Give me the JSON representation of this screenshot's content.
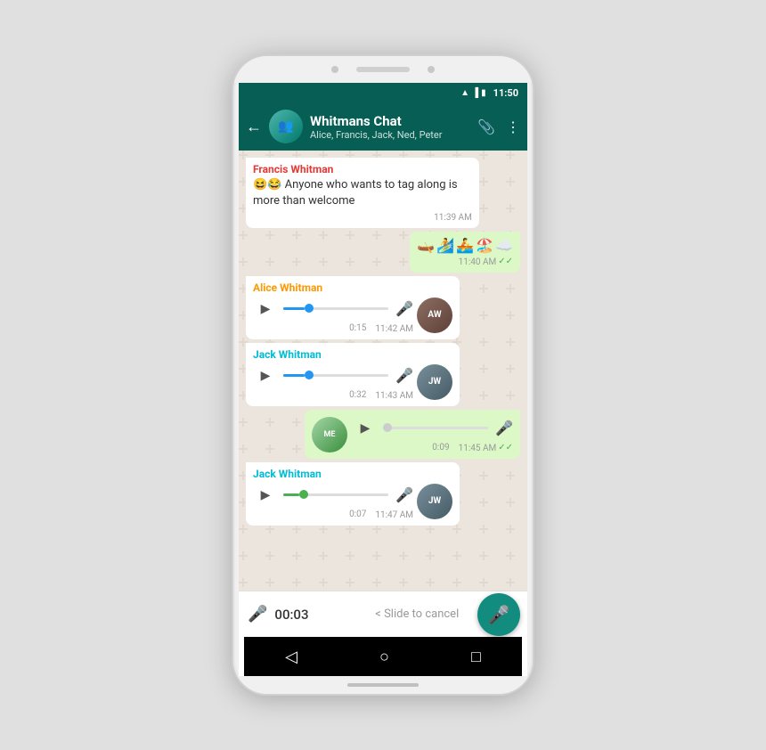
{
  "statusBar": {
    "time": "11:50",
    "icons": [
      "wifi",
      "signal",
      "battery"
    ]
  },
  "header": {
    "title": "Whitmans Chat",
    "subtitle": "Alice, Francis, Jack, Ned, Peter",
    "backLabel": "←",
    "attachIcon": "📎",
    "moreIcon": "⋮"
  },
  "messages": [
    {
      "id": "msg1",
      "type": "text",
      "sender": "Francis Whitman",
      "senderClass": "sender-francis",
      "direction": "received",
      "text": "😆😂 Anyone who wants to tag along is more than welcome",
      "time": "11:39 AM",
      "hasCheck": false
    },
    {
      "id": "msg2",
      "type": "emoji",
      "direction": "sent",
      "emojis": "🛶🏄🚣🏖️",
      "time": "11:40 AM",
      "hasCheck": true
    },
    {
      "id": "msg3",
      "type": "voice",
      "sender": "Alice Whitman",
      "senderClass": "sender-alice",
      "direction": "received",
      "duration": "0:15",
      "time": "11:42 AM",
      "hasCheck": false,
      "waveColor": "blue",
      "avatarClass": "avatar-alice",
      "avatarLabel": "AW"
    },
    {
      "id": "msg4",
      "type": "voice",
      "sender": "Jack Whitman",
      "senderClass": "sender-jack",
      "direction": "received",
      "duration": "0:32",
      "time": "11:43 AM",
      "hasCheck": false,
      "waveColor": "blue",
      "avatarClass": "avatar-jack",
      "avatarLabel": "JW"
    },
    {
      "id": "msg5",
      "type": "voice",
      "direction": "sent",
      "duration": "0:09",
      "time": "11:45 AM",
      "hasCheck": true,
      "waveColor": "gray",
      "avatarClass": "avatar-me",
      "avatarLabel": "ME"
    },
    {
      "id": "msg6",
      "type": "voice",
      "sender": "Jack Whitman",
      "senderClass": "sender-jack",
      "direction": "received",
      "duration": "0:07",
      "time": "11:47 AM",
      "hasCheck": false,
      "waveColor": "green",
      "avatarClass": "avatar-jack",
      "avatarLabel": "JW"
    }
  ],
  "recordingBar": {
    "timer": "00:03",
    "slideText": "< Slide to cancel",
    "micIcon": "🎤",
    "sendIcon": "🎤"
  },
  "nav": {
    "backIcon": "◁",
    "homeIcon": "○",
    "recentIcon": "□"
  }
}
